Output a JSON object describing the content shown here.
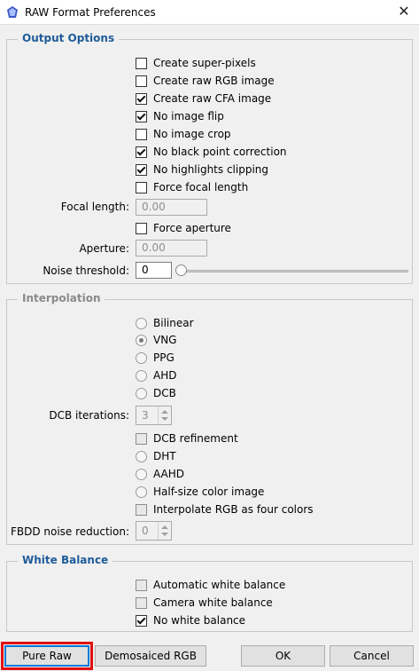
{
  "window": {
    "title": "RAW Format Preferences",
    "close_glyph": "✕",
    "icon": "app-logo-icon"
  },
  "output_options": {
    "title": "Output Options",
    "checkboxes": [
      {
        "label": "Create super-pixels",
        "checked": false
      },
      {
        "label": "Create raw RGB image",
        "checked": false
      },
      {
        "label": "Create raw CFA image",
        "checked": true
      },
      {
        "label": "No image flip",
        "checked": true
      },
      {
        "label": "No image crop",
        "checked": false
      },
      {
        "label": "No black point correction",
        "checked": true
      },
      {
        "label": "No highlights clipping",
        "checked": true
      },
      {
        "label": "Force focal length",
        "checked": false
      }
    ],
    "focal_length": {
      "label": "Focal length:",
      "value": "0.00"
    },
    "force_aperture": {
      "label": "Force aperture",
      "checked": false
    },
    "aperture": {
      "label": "Aperture:",
      "value": "0.00"
    },
    "noise_threshold": {
      "label": "Noise threshold:",
      "value": "0",
      "slider_value": 0
    }
  },
  "interpolation": {
    "title": "Interpolation",
    "radios_a": [
      {
        "label": "Bilinear",
        "checked": false
      },
      {
        "label": "VNG",
        "checked": true
      },
      {
        "label": "PPG",
        "checked": false
      },
      {
        "label": "AHD",
        "checked": false
      },
      {
        "label": "DCB",
        "checked": false
      }
    ],
    "dcb_iterations": {
      "label": "DCB iterations:",
      "value": "3"
    },
    "dcb_refinement": {
      "label": "DCB refinement",
      "checked": false
    },
    "radios_b": [
      {
        "label": "DHT",
        "checked": false
      },
      {
        "label": "AAHD",
        "checked": false
      },
      {
        "label": "Half-size color image",
        "checked": false
      }
    ],
    "interpolate_rgb": {
      "label": "Interpolate RGB as four colors",
      "checked": false
    },
    "fbdd": {
      "label": "FBDD noise reduction:",
      "value": "0"
    }
  },
  "white_balance": {
    "title": "White Balance",
    "checkboxes": [
      {
        "label": "Automatic white balance",
        "checked": false
      },
      {
        "label": "Camera white balance",
        "checked": false
      },
      {
        "label": "No white balance",
        "checked": true
      }
    ]
  },
  "buttons": {
    "pure_raw": "Pure Raw",
    "demosaiced_rgb": "Demosaiced RGB",
    "ok": "OK",
    "cancel": "Cancel"
  },
  "colors": {
    "group_title": "#1f5c99",
    "disabled_title": "#8a8a8a",
    "highlight": "#e01010",
    "accent": "#0078d7"
  }
}
